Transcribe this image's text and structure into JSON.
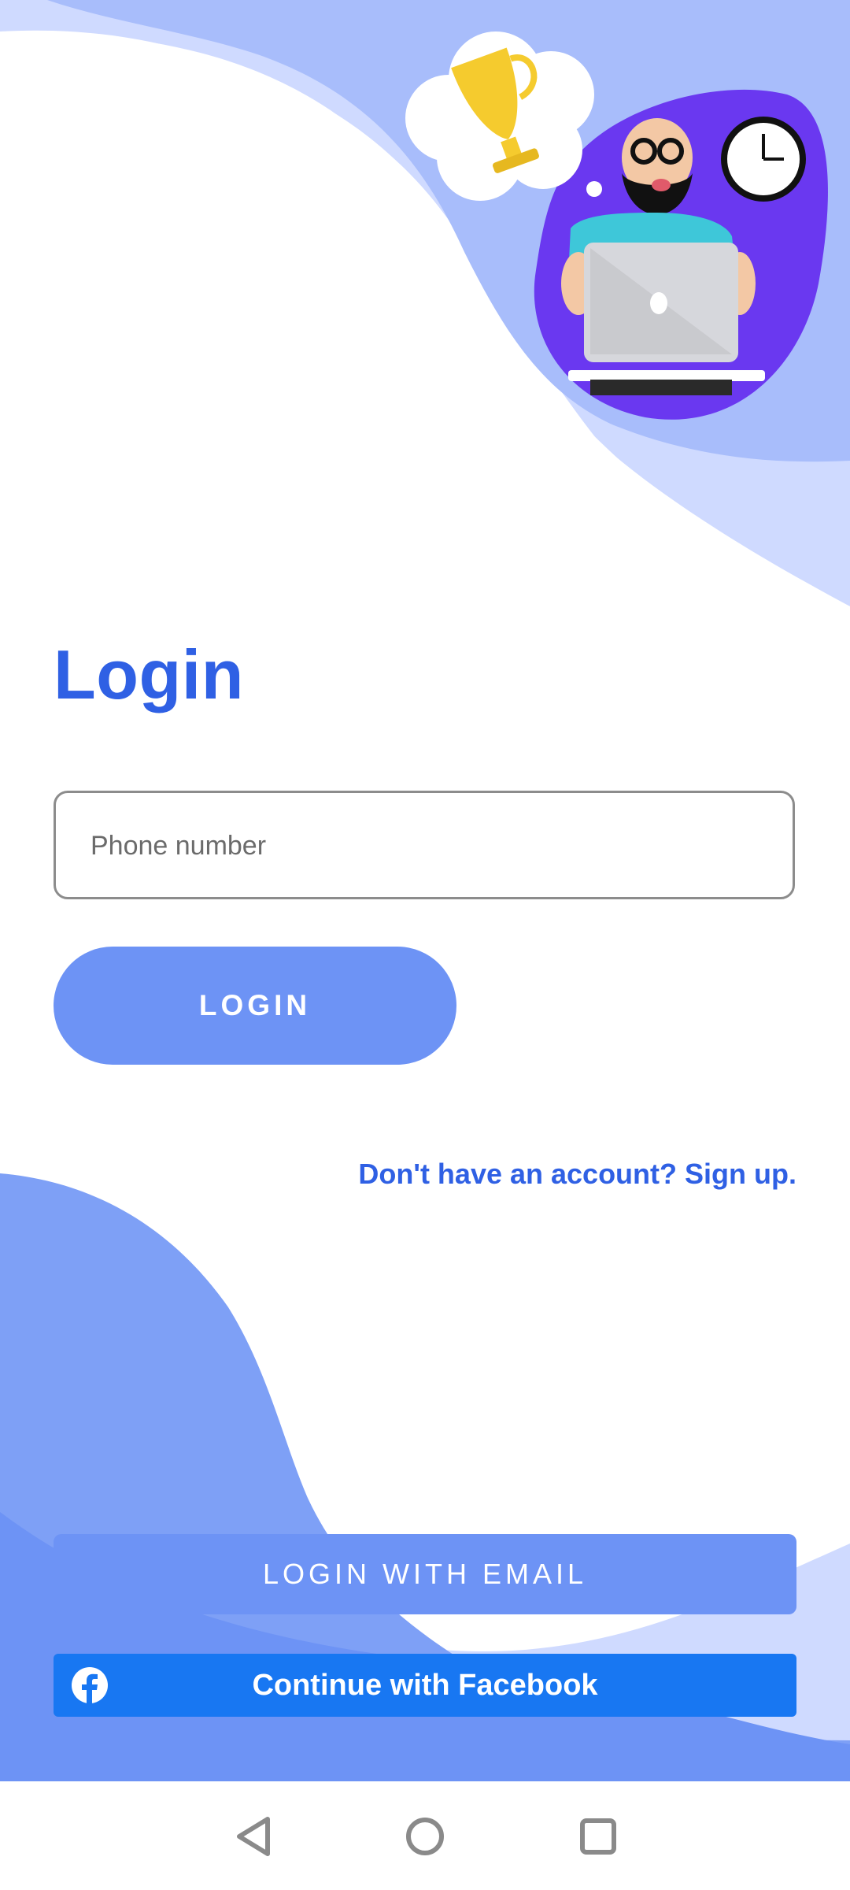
{
  "colors": {
    "accent": "#2f60e4",
    "button_fill": "#6d93f5",
    "facebook_blue": "#1877f2",
    "wave_light": "#cfdaff",
    "wave_mid": "#a8bdfb",
    "wave_dark": "#7ea0f6",
    "blob_purple": "#6a38f0"
  },
  "header": {
    "illustration_icon": "man-with-laptop-dreaming-of-trophy-illustration"
  },
  "login": {
    "title": "Login",
    "phone_placeholder": "Phone number",
    "phone_value": "",
    "login_button_label": "LOGIN",
    "signup_link": "Don't have an account? Sign up."
  },
  "alt_login": {
    "email_button_label": "LOGIN WITH EMAIL",
    "facebook_button_label": "Continue with Facebook",
    "facebook_icon": "facebook-icon"
  },
  "navigation": {
    "back_icon": "back-triangle-icon",
    "home_icon": "home-circle-icon",
    "recents_icon": "recents-square-icon"
  }
}
